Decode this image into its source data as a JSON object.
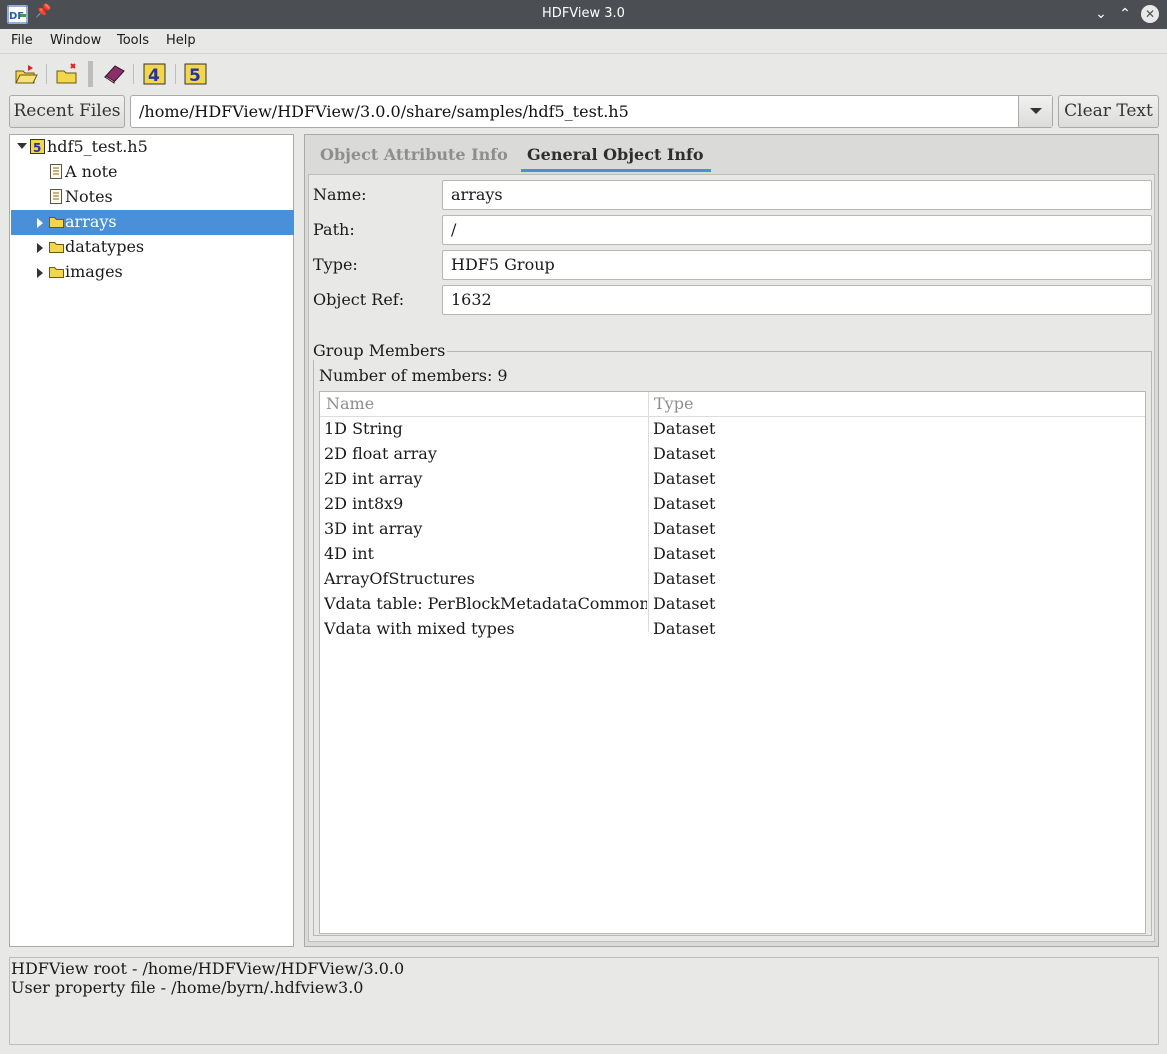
{
  "window": {
    "title": "HDFView 3.0"
  },
  "menu": {
    "file": "File",
    "window": "Window",
    "tools": "Tools",
    "help": "Help"
  },
  "toolbar": {
    "icons": [
      "open-file-icon",
      "close-file-icon",
      "help-book-icon",
      "hdf4-library-icon",
      "hdf5-library-icon"
    ]
  },
  "url_bar": {
    "recent_files_label": "Recent Files",
    "path_value": "/home/HDFView/HDFView/3.0.0/share/samples/hdf5_test.h5",
    "clear_text_label": "Clear Text"
  },
  "tree": {
    "root": "hdf5_test.h5",
    "items": [
      {
        "label": "A note",
        "kind": "note"
      },
      {
        "label": "Notes",
        "kind": "note"
      },
      {
        "label": "arrays",
        "kind": "folder",
        "selected": true
      },
      {
        "label": "datatypes",
        "kind": "folder"
      },
      {
        "label": "images",
        "kind": "folder"
      }
    ]
  },
  "tabs": {
    "attribute": "Object Attribute Info",
    "general": "General Object Info"
  },
  "info": {
    "name_label": "Name:",
    "name_value": "arrays",
    "path_label": "Path:",
    "path_value": "/",
    "type_label": "Type:",
    "type_value": "HDF5 Group",
    "ref_label": "Object Ref:",
    "ref_value": "1632"
  },
  "group": {
    "title": "Group Members",
    "count_text": "Number of members: 9",
    "columns": [
      "Name",
      "Type"
    ],
    "rows": [
      [
        "1D String",
        "Dataset"
      ],
      [
        "2D float array",
        "Dataset"
      ],
      [
        "2D int array",
        "Dataset"
      ],
      [
        "2D int8x9",
        "Dataset"
      ],
      [
        "3D int array",
        "Dataset"
      ],
      [
        "4D int",
        "Dataset"
      ],
      [
        "ArrayOfStructures",
        "Dataset"
      ],
      [
        "Vdata table: PerBlockMetadataCommon",
        "Dataset"
      ],
      [
        "Vdata with mixed types",
        "Dataset"
      ]
    ]
  },
  "status": {
    "line1": "HDFView root - /home/HDFView/HDFView/3.0.0",
    "line2": "User property file - /home/byrn/.hdfview3.0"
  }
}
